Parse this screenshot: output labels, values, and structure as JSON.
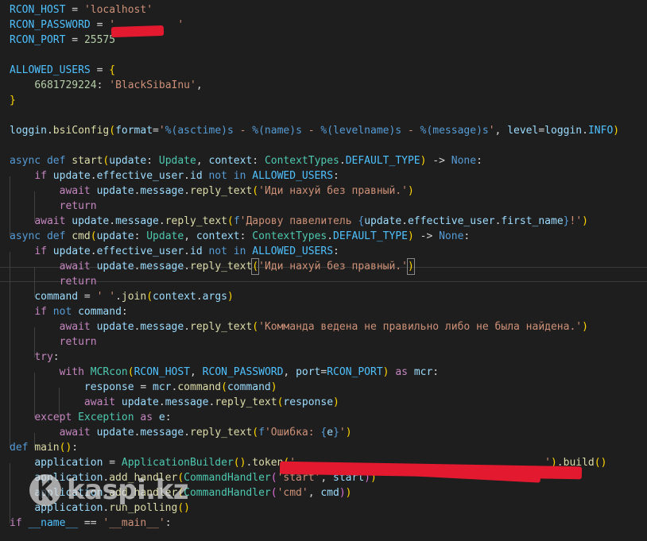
{
  "colors": {
    "background": "#1e1e1e",
    "redaction": "#e3192f"
  },
  "watermark": {
    "text": "kaspi.kz",
    "icon": "kaspi-logo-icon"
  },
  "code": {
    "lines": [
      [
        [
          "RCON_HOST",
          "v"
        ],
        [
          " = ",
          "p"
        ],
        [
          "'localhost'",
          "s"
        ]
      ],
      [
        [
          "RCON_PASSWORD",
          "v"
        ],
        [
          " = ",
          "p"
        ],
        [
          "'",
          "s"
        ],
        [
          "          ",
          "s"
        ],
        [
          "'",
          "s"
        ]
      ],
      [
        [
          "RCON_PORT",
          "v"
        ],
        [
          " = ",
          "p"
        ],
        [
          "25575",
          "num"
        ]
      ],
      [],
      [
        [
          "ALLOWED_USERS",
          "v"
        ],
        [
          " = ",
          "p"
        ],
        [
          "{",
          "br1"
        ]
      ],
      [
        [
          "    ",
          "p"
        ],
        [
          "6681729224",
          "num"
        ],
        [
          ": ",
          "p"
        ],
        [
          "'BlackSibaInu'",
          "s"
        ],
        [
          ",",
          "p"
        ]
      ],
      [
        [
          "}",
          "br1"
        ]
      ],
      [],
      [
        [
          "loggin",
          "n"
        ],
        [
          ".",
          "p"
        ],
        [
          "bsiConfig",
          "f"
        ],
        [
          "(",
          "br1"
        ],
        [
          "format",
          "n"
        ],
        [
          "=",
          "p"
        ],
        [
          "'",
          "s"
        ],
        [
          "%(asctime)s",
          "k"
        ],
        [
          " - ",
          "s"
        ],
        [
          "%(name)s",
          "k"
        ],
        [
          " - ",
          "s"
        ],
        [
          "%(levelname)s",
          "k"
        ],
        [
          " - ",
          "s"
        ],
        [
          "%(message)s",
          "k"
        ],
        [
          "'",
          "s"
        ],
        [
          ", ",
          "p"
        ],
        [
          "level",
          "n"
        ],
        [
          "=",
          "p"
        ],
        [
          "loggin",
          "n"
        ],
        [
          ".",
          "p"
        ],
        [
          "INFO",
          "v"
        ],
        [
          ")",
          "br1"
        ]
      ],
      [],
      [
        [
          "async",
          "k"
        ],
        [
          " ",
          "p"
        ],
        [
          "def",
          "k"
        ],
        [
          " ",
          "p"
        ],
        [
          "start",
          "f"
        ],
        [
          "(",
          "br1"
        ],
        [
          "update",
          "n"
        ],
        [
          ": ",
          "p"
        ],
        [
          "Update",
          "t"
        ],
        [
          ", ",
          "p"
        ],
        [
          "context",
          "n"
        ],
        [
          ": ",
          "p"
        ],
        [
          "ContextTypes",
          "t"
        ],
        [
          ".",
          "p"
        ],
        [
          "DEFAULT_TYPE",
          "v"
        ],
        [
          ")",
          "br1"
        ],
        [
          " -> ",
          "p"
        ],
        [
          "None",
          "k"
        ],
        [
          ":",
          "p"
        ]
      ],
      [
        [
          "    ",
          "p"
        ],
        [
          "if",
          "c"
        ],
        [
          " ",
          "p"
        ],
        [
          "update",
          "n"
        ],
        [
          ".",
          "p"
        ],
        [
          "effective_user",
          "n"
        ],
        [
          ".",
          "p"
        ],
        [
          "id",
          "n"
        ],
        [
          " ",
          "p"
        ],
        [
          "not",
          "k"
        ],
        [
          " ",
          "p"
        ],
        [
          "in",
          "k"
        ],
        [
          " ",
          "p"
        ],
        [
          "ALLOWED_USERS",
          "v"
        ],
        [
          ":",
          "p"
        ]
      ],
      [
        [
          "        ",
          "p"
        ],
        [
          "await",
          "c"
        ],
        [
          " ",
          "p"
        ],
        [
          "update",
          "n"
        ],
        [
          ".",
          "p"
        ],
        [
          "message",
          "n"
        ],
        [
          ".",
          "p"
        ],
        [
          "reply_text",
          "f"
        ],
        [
          "(",
          "br1"
        ],
        [
          "'Иди нахуй без правный.'",
          "s"
        ],
        [
          ")",
          "br1"
        ]
      ],
      [
        [
          "        ",
          "p"
        ],
        [
          "return",
          "c"
        ]
      ],
      [
        [
          "    ",
          "p"
        ],
        [
          "await",
          "c"
        ],
        [
          " ",
          "p"
        ],
        [
          "update",
          "n"
        ],
        [
          ".",
          "p"
        ],
        [
          "message",
          "n"
        ],
        [
          ".",
          "p"
        ],
        [
          "reply_text",
          "f"
        ],
        [
          "(",
          "br1"
        ],
        [
          "f",
          "k"
        ],
        [
          "'Дарову павелитель ",
          "s"
        ],
        [
          "{",
          "k"
        ],
        [
          "update",
          "n"
        ],
        [
          ".",
          "p"
        ],
        [
          "effective_user",
          "n"
        ],
        [
          ".",
          "p"
        ],
        [
          "first_name",
          "n"
        ],
        [
          "}",
          "k"
        ],
        [
          "!'",
          "s"
        ],
        [
          ")",
          "br1"
        ]
      ],
      [
        [
          "async",
          "k"
        ],
        [
          " ",
          "p"
        ],
        [
          "def",
          "k"
        ],
        [
          " ",
          "p"
        ],
        [
          "cmd",
          "f"
        ],
        [
          "(",
          "br1"
        ],
        [
          "update",
          "n"
        ],
        [
          ": ",
          "p"
        ],
        [
          "Update",
          "t"
        ],
        [
          ", ",
          "p"
        ],
        [
          "context",
          "n"
        ],
        [
          ": ",
          "p"
        ],
        [
          "ContextTypes",
          "t"
        ],
        [
          ".",
          "p"
        ],
        [
          "DEFAULT_TYPE",
          "v"
        ],
        [
          ")",
          "br1"
        ],
        [
          " -> ",
          "p"
        ],
        [
          "None",
          "k"
        ],
        [
          ":",
          "p"
        ]
      ],
      [
        [
          "    ",
          "p"
        ],
        [
          "if",
          "c"
        ],
        [
          " ",
          "p"
        ],
        [
          "update",
          "n"
        ],
        [
          ".",
          "p"
        ],
        [
          "effective_user",
          "n"
        ],
        [
          ".",
          "p"
        ],
        [
          "id",
          "n"
        ],
        [
          " ",
          "p"
        ],
        [
          "not",
          "k"
        ],
        [
          " ",
          "p"
        ],
        [
          "in",
          "k"
        ],
        [
          " ",
          "p"
        ],
        [
          "ALLOWED_USERS",
          "v"
        ],
        [
          ":",
          "p"
        ]
      ],
      [
        [
          "        ",
          "p"
        ],
        [
          "await",
          "c"
        ],
        [
          " ",
          "p"
        ],
        [
          "update",
          "n"
        ],
        [
          ".",
          "p"
        ],
        [
          "message",
          "n"
        ],
        [
          ".",
          "p"
        ],
        [
          "reply_text",
          "f"
        ],
        [
          "(",
          "br1",
          "box"
        ],
        [
          "'Иди нахуй без правный.'",
          "s"
        ],
        [
          ")",
          "br1",
          "box"
        ]
      ],
      [
        [
          "        ",
          "p"
        ],
        [
          "return",
          "c"
        ]
      ],
      [
        [
          "    ",
          "p"
        ],
        [
          "command",
          "n"
        ],
        [
          " = ",
          "p"
        ],
        [
          "' '",
          "s"
        ],
        [
          ".",
          "p"
        ],
        [
          "join",
          "f"
        ],
        [
          "(",
          "br1"
        ],
        [
          "context",
          "n"
        ],
        [
          ".",
          "p"
        ],
        [
          "args",
          "n"
        ],
        [
          ")",
          "br1"
        ]
      ],
      [
        [
          "    ",
          "p"
        ],
        [
          "if",
          "c"
        ],
        [
          " ",
          "p"
        ],
        [
          "not",
          "k"
        ],
        [
          " ",
          "p"
        ],
        [
          "command",
          "n"
        ],
        [
          ":",
          "p"
        ]
      ],
      [
        [
          "        ",
          "p"
        ],
        [
          "await",
          "c"
        ],
        [
          " ",
          "p"
        ],
        [
          "update",
          "n"
        ],
        [
          ".",
          "p"
        ],
        [
          "message",
          "n"
        ],
        [
          ".",
          "p"
        ],
        [
          "reply_text",
          "f"
        ],
        [
          "(",
          "br1"
        ],
        [
          "'Комманда ведена не правильно либо не была найдена.'",
          "s"
        ],
        [
          ")",
          "br1"
        ]
      ],
      [
        [
          "        ",
          "p"
        ],
        [
          "return",
          "c"
        ]
      ],
      [
        [
          "    ",
          "p"
        ],
        [
          "try",
          "c"
        ],
        [
          ":",
          "p"
        ]
      ],
      [
        [
          "        ",
          "p"
        ],
        [
          "with",
          "c"
        ],
        [
          " ",
          "p"
        ],
        [
          "MCRcon",
          "t"
        ],
        [
          "(",
          "br1"
        ],
        [
          "RCON_HOST",
          "v"
        ],
        [
          ", ",
          "p"
        ],
        [
          "RCON_PASSWORD",
          "v"
        ],
        [
          ", ",
          "p"
        ],
        [
          "port",
          "n"
        ],
        [
          "=",
          "p"
        ],
        [
          "RCON_PORT",
          "v"
        ],
        [
          ")",
          "br1"
        ],
        [
          " ",
          "p"
        ],
        [
          "as",
          "c"
        ],
        [
          " ",
          "p"
        ],
        [
          "mcr",
          "n"
        ],
        [
          ":",
          "p"
        ]
      ],
      [
        [
          "            ",
          "p"
        ],
        [
          "response",
          "n"
        ],
        [
          " = ",
          "p"
        ],
        [
          "mcr",
          "n"
        ],
        [
          ".",
          "p"
        ],
        [
          "command",
          "f"
        ],
        [
          "(",
          "br1"
        ],
        [
          "command",
          "n"
        ],
        [
          ")",
          "br1"
        ]
      ],
      [
        [
          "            ",
          "p"
        ],
        [
          "await",
          "c"
        ],
        [
          " ",
          "p"
        ],
        [
          "update",
          "n"
        ],
        [
          ".",
          "p"
        ],
        [
          "message",
          "n"
        ],
        [
          ".",
          "p"
        ],
        [
          "reply_text",
          "f"
        ],
        [
          "(",
          "br1"
        ],
        [
          "response",
          "n"
        ],
        [
          ")",
          "br1"
        ]
      ],
      [
        [
          "    ",
          "p"
        ],
        [
          "except",
          "c"
        ],
        [
          " ",
          "p"
        ],
        [
          "Exception",
          "t"
        ],
        [
          " ",
          "p"
        ],
        [
          "as",
          "c"
        ],
        [
          " ",
          "p"
        ],
        [
          "e",
          "n"
        ],
        [
          ":",
          "p"
        ]
      ],
      [
        [
          "        ",
          "p"
        ],
        [
          "await",
          "c"
        ],
        [
          " ",
          "p"
        ],
        [
          "update",
          "n"
        ],
        [
          ".",
          "p"
        ],
        [
          "message",
          "n"
        ],
        [
          ".",
          "p"
        ],
        [
          "reply_text",
          "f"
        ],
        [
          "(",
          "br1"
        ],
        [
          "f",
          "k"
        ],
        [
          "'Ошибка: ",
          "s"
        ],
        [
          "{",
          "k"
        ],
        [
          "e",
          "n"
        ],
        [
          "}",
          "k"
        ],
        [
          "'",
          "s"
        ],
        [
          ")",
          "br1"
        ]
      ],
      [
        [
          "def",
          "k"
        ],
        [
          " ",
          "p"
        ],
        [
          "main",
          "f"
        ],
        [
          "(",
          "br1"
        ],
        [
          ")",
          "br1"
        ],
        [
          ":",
          "p"
        ]
      ],
      [
        [
          "    ",
          "p"
        ],
        [
          "application",
          "n"
        ],
        [
          " = ",
          "p"
        ],
        [
          "ApplicationBuilder",
          "t"
        ],
        [
          "(",
          "br1"
        ],
        [
          ")",
          "br1"
        ],
        [
          ".",
          "p"
        ],
        [
          "token",
          "f"
        ],
        [
          "(",
          "br1"
        ],
        [
          "'",
          "s"
        ],
        [
          "                                        ",
          "s"
        ],
        [
          "'",
          "s"
        ],
        [
          ")",
          "br1"
        ],
        [
          ".",
          "p"
        ],
        [
          "build",
          "f"
        ],
        [
          "(",
          "br1"
        ],
        [
          ")",
          "br1"
        ]
      ],
      [
        [
          "    ",
          "p"
        ],
        [
          "application",
          "n"
        ],
        [
          ".",
          "p"
        ],
        [
          "add_handler",
          "f"
        ],
        [
          "(",
          "br1"
        ],
        [
          "CommandHandler",
          "t"
        ],
        [
          "(",
          "br2"
        ],
        [
          "'start'",
          "s"
        ],
        [
          ", ",
          "p"
        ],
        [
          "start",
          "n"
        ],
        [
          ")",
          "br2"
        ],
        [
          ")",
          "br1"
        ]
      ],
      [
        [
          "    ",
          "p"
        ],
        [
          "application",
          "n"
        ],
        [
          ".",
          "p"
        ],
        [
          "add_handler",
          "f"
        ],
        [
          "(",
          "br1"
        ],
        [
          "CommandHandler",
          "t"
        ],
        [
          "(",
          "br2"
        ],
        [
          "'cmd'",
          "s"
        ],
        [
          ", ",
          "p"
        ],
        [
          "cmd",
          "n"
        ],
        [
          ")",
          "br2"
        ],
        [
          ")",
          "br1"
        ]
      ],
      [
        [
          "    ",
          "p"
        ],
        [
          "application",
          "n"
        ],
        [
          ".",
          "p"
        ],
        [
          "run_polling",
          "f"
        ],
        [
          "(",
          "br1"
        ],
        [
          ")",
          "br1"
        ]
      ],
      [
        [
          "if",
          "c"
        ],
        [
          " ",
          "p"
        ],
        [
          "__name__",
          "v"
        ],
        [
          " == ",
          "p"
        ],
        [
          "'__main__'",
          "s"
        ],
        [
          ":",
          "p"
        ]
      ]
    ]
  }
}
